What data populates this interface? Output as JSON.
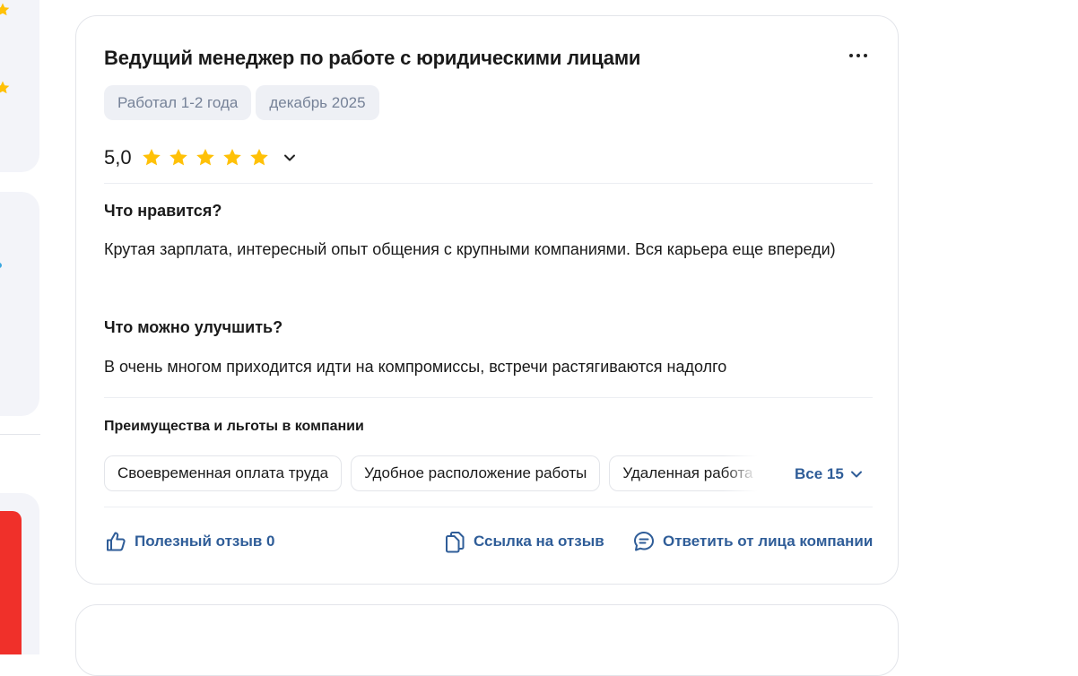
{
  "review": {
    "title": "Ведущий менеджер по работе с юридическими лицами",
    "tags": [
      "Работал 1-2 года",
      "декабрь 2025"
    ],
    "rating": {
      "value_label": "5,0",
      "stars": 5,
      "max": 5,
      "star_color": "#ffc107"
    },
    "likes_question": "Что нравится?",
    "likes_answer": "Крутая зарплата, интересный опыт общения с крупными компаниями. Вся карьера еще впереди)",
    "improve_question": "Что можно улучшить?",
    "improve_answer": "В очень многом приходится идти на компромиссы, встречи растягиваются надолго",
    "benefits_title": "Преимущества и льготы в компании",
    "benefits": [
      "Своевременная оплата труда",
      "Удобное расположение работы",
      "Удаленная работа"
    ],
    "benefits_all_label": "Все 15",
    "actions": {
      "helpful_label": "Полезный отзыв 0",
      "link_label": "Ссылка на отзыв",
      "reply_label": "Ответить от лица компании"
    }
  },
  "icons": {
    "more": "more-dots-icon",
    "chevron": "chevron-down-icon",
    "helpful": "thumbs-up-icon",
    "link": "copy-link-icon",
    "reply": "comment-icon"
  },
  "colors": {
    "accent": "#2f5d98",
    "chip_bg": "#eef0f5",
    "chip_text": "#768298",
    "star": "#ffc107",
    "sidebar_bg": "#f3f4f9",
    "sidebar_red": "#f0302a"
  }
}
